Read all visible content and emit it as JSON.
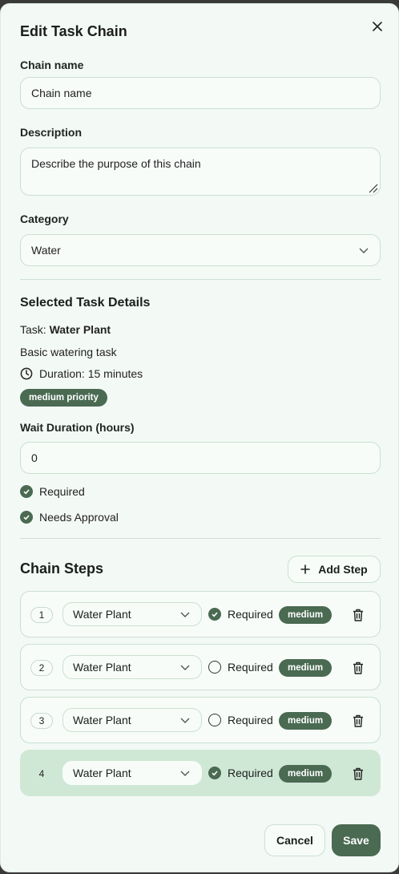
{
  "dialog": {
    "title": "Edit Task Chain",
    "close_label": "×"
  },
  "form": {
    "chain_name_label": "Chain name",
    "chain_name_placeholder": "Chain name",
    "description_label": "Description",
    "description_placeholder": "Describe the purpose of this chain",
    "category_label": "Category",
    "category_value": "Water"
  },
  "task_details": {
    "title": "Selected Task Details",
    "task_prefix": "Task:",
    "task_name": "Water Plant",
    "description": "Basic watering task",
    "duration": "Duration: 15 minutes",
    "priority": "medium priority",
    "wait_label": "Wait Duration (hours)",
    "wait_value": "0",
    "required_label": "Required",
    "needs_approval_label": "Needs Approval"
  },
  "chain_steps": {
    "title": "Chain Steps",
    "add_step_label": "Add Step",
    "steps": [
      {
        "number": "1",
        "task": "Water Plant",
        "required_label": "Required",
        "required": true,
        "priority": "medium"
      },
      {
        "number": "2",
        "task": "Water Plant",
        "required_label": "Required",
        "required": false,
        "priority": "medium"
      },
      {
        "number": "3",
        "task": "Water Plant",
        "required_label": "Required",
        "required": false,
        "priority": "medium"
      },
      {
        "number": "4",
        "task": "Water Plant",
        "required_label": "Required",
        "required": true,
        "priority": "medium"
      }
    ]
  },
  "footer": {
    "cancel_label": "Cancel",
    "save_label": "Save"
  },
  "colors": {
    "accent": "#4a6a52",
    "background": "#f3f9f5",
    "border": "#c9e1d0",
    "active_step": "#cfe8d6"
  }
}
